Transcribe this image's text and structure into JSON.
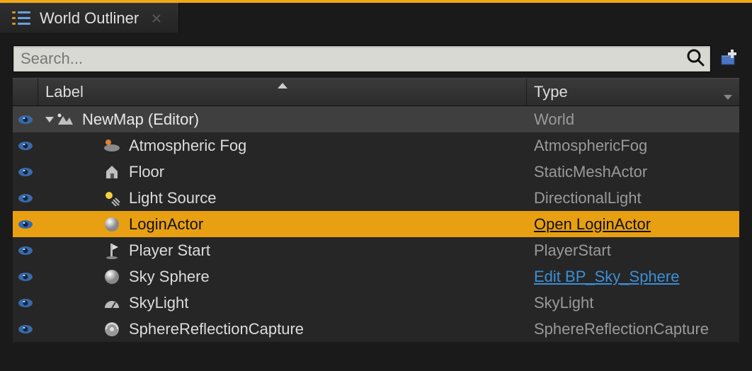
{
  "tab": {
    "title": "World Outliner"
  },
  "search": {
    "placeholder": "Search..."
  },
  "columns": {
    "label": "Label",
    "type": "Type"
  },
  "root": {
    "label": "NewMap (Editor)",
    "type": "World",
    "icon": "world-icon"
  },
  "items": [
    {
      "label": "Atmospheric Fog",
      "type": "AtmosphericFog",
      "icon": "fog-icon",
      "selected": false,
      "link": false
    },
    {
      "label": "Floor",
      "type": "StaticMeshActor",
      "icon": "house-icon",
      "selected": false,
      "link": false
    },
    {
      "label": "Light Source",
      "type": "DirectionalLight",
      "icon": "sun-icon",
      "selected": false,
      "link": false
    },
    {
      "label": "LoginActor",
      "type": "Open LoginActor",
      "icon": "sphere-icon",
      "selected": true,
      "link": true
    },
    {
      "label": "Player Start",
      "type": "PlayerStart",
      "icon": "flag-icon",
      "selected": false,
      "link": false
    },
    {
      "label": "Sky Sphere",
      "type": "Edit BP_Sky_Sphere",
      "icon": "sphere-icon",
      "selected": false,
      "link": true
    },
    {
      "label": "SkyLight",
      "type": "SkyLight",
      "icon": "gauge-icon",
      "selected": false,
      "link": false
    },
    {
      "label": "SphereReflectionCapture",
      "type": "SphereReflectionCapture",
      "icon": "reflection-icon",
      "selected": false,
      "link": false
    }
  ]
}
